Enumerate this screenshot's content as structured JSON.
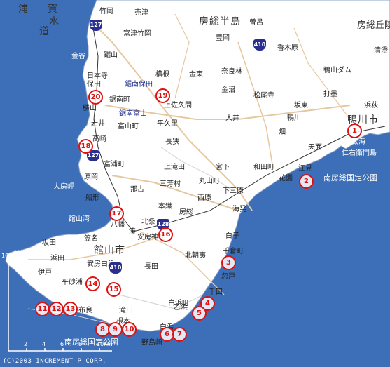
{
  "map": {
    "region_label": "房総半島",
    "sea_label_a": "浦",
    "sea_label_b": "賀",
    "sea_label_c": "水",
    "sea_label_d": "道",
    "park_label_east": "南房総国定公園",
    "park_label_south": "南房総国定公園",
    "copyright": "(C)2003 INCREMENT P CORP.",
    "scale": {
      "title": "10km",
      "ticks": [
        "2",
        "4",
        "6",
        "8",
        "10km"
      ]
    },
    "cities": [
      {
        "name": "館山市"
      },
      {
        "name": "鴨川市"
      },
      {
        "name": "房総丘陵"
      }
    ],
    "places": [
      {
        "name": "竹岡"
      },
      {
        "name": "売津"
      },
      {
        "name": "富津竹岡"
      },
      {
        "name": "金谷"
      },
      {
        "name": "鋸山"
      },
      {
        "name": "日本寺"
      },
      {
        "name": "保田"
      },
      {
        "name": "鋸南保田"
      },
      {
        "name": "鋸南町"
      },
      {
        "name": "勝山"
      },
      {
        "name": "鋸南富山"
      },
      {
        "name": "岩井"
      },
      {
        "name": "富山町"
      },
      {
        "name": "高崎"
      },
      {
        "name": "富浦町"
      },
      {
        "name": "原岡"
      },
      {
        "name": "大房岬"
      },
      {
        "name": "船形"
      },
      {
        "name": "館山湾"
      },
      {
        "name": "八幡"
      },
      {
        "name": "那古"
      },
      {
        "name": "北条"
      },
      {
        "name": "湊"
      },
      {
        "name": "坂田"
      },
      {
        "name": "洲崎"
      },
      {
        "name": "浜田"
      },
      {
        "name": "伊戸"
      },
      {
        "name": "平砂浦"
      },
      {
        "name": "布良"
      },
      {
        "name": "相浜"
      },
      {
        "name": "根本"
      },
      {
        "name": "滝口"
      },
      {
        "name": "白浜町"
      },
      {
        "name": "白浜"
      },
      {
        "name": "野島崎"
      },
      {
        "name": "乙浜"
      },
      {
        "name": "千田"
      },
      {
        "name": "忽戸"
      },
      {
        "name": "千倉町"
      },
      {
        "name": "白子"
      },
      {
        "name": "北朝夷"
      },
      {
        "name": "長田"
      },
      {
        "name": "安房神社"
      },
      {
        "name": "安房白浜"
      },
      {
        "name": "笠名"
      },
      {
        "name": "豊岡"
      },
      {
        "name": "金束"
      },
      {
        "name": "奈良林"
      },
      {
        "name": "横根"
      },
      {
        "name": "上佐久間"
      },
      {
        "name": "平久里"
      },
      {
        "name": "大井"
      },
      {
        "name": "長狭"
      },
      {
        "name": "坂東"
      },
      {
        "name": "畑"
      },
      {
        "name": "鴨川"
      },
      {
        "name": "太海"
      },
      {
        "name": "仁右衛門島"
      },
      {
        "name": "浜荻"
      },
      {
        "name": "天面"
      },
      {
        "name": "江見"
      },
      {
        "name": "花園"
      },
      {
        "name": "和田町"
      },
      {
        "name": "宮下"
      },
      {
        "name": "上滝田"
      },
      {
        "name": "丸山町"
      },
      {
        "name": "三芳村"
      },
      {
        "name": "下三原"
      },
      {
        "name": "本織"
      },
      {
        "name": "西原"
      },
      {
        "name": "海発"
      },
      {
        "name": "加茂"
      },
      {
        "name": "大畑"
      },
      {
        "name": "川谷"
      },
      {
        "name": "松尾寺"
      },
      {
        "name": "打墨"
      },
      {
        "name": "香木原"
      },
      {
        "name": "清澄"
      },
      {
        "name": "鴨山ダム"
      },
      {
        "name": "曽呂"
      },
      {
        "name": "保台"
      },
      {
        "name": "金沼"
      },
      {
        "name": "大崎"
      },
      {
        "name": "房総"
      }
    ],
    "route_shields": [
      {
        "label": "127"
      },
      {
        "label": "410"
      },
      {
        "label": "127"
      },
      {
        "label": "128"
      },
      {
        "label": "410"
      }
    ],
    "markers": [
      {
        "num": "1"
      },
      {
        "num": "2"
      },
      {
        "num": "3"
      },
      {
        "num": "4"
      },
      {
        "num": "5"
      },
      {
        "num": "6"
      },
      {
        "num": "7"
      },
      {
        "num": "8"
      },
      {
        "num": "9"
      },
      {
        "num": "10"
      },
      {
        "num": "11"
      },
      {
        "num": "12"
      },
      {
        "num": "13"
      },
      {
        "num": "14"
      },
      {
        "num": "15"
      },
      {
        "num": "16"
      },
      {
        "num": "17"
      },
      {
        "num": "18"
      },
      {
        "num": "19"
      },
      {
        "num": "20"
      }
    ],
    "colors": {
      "sea": "#3c6fb7",
      "land": "#ffffff",
      "marker": "#e01010",
      "route_shield": "#2a2f8f"
    }
  }
}
